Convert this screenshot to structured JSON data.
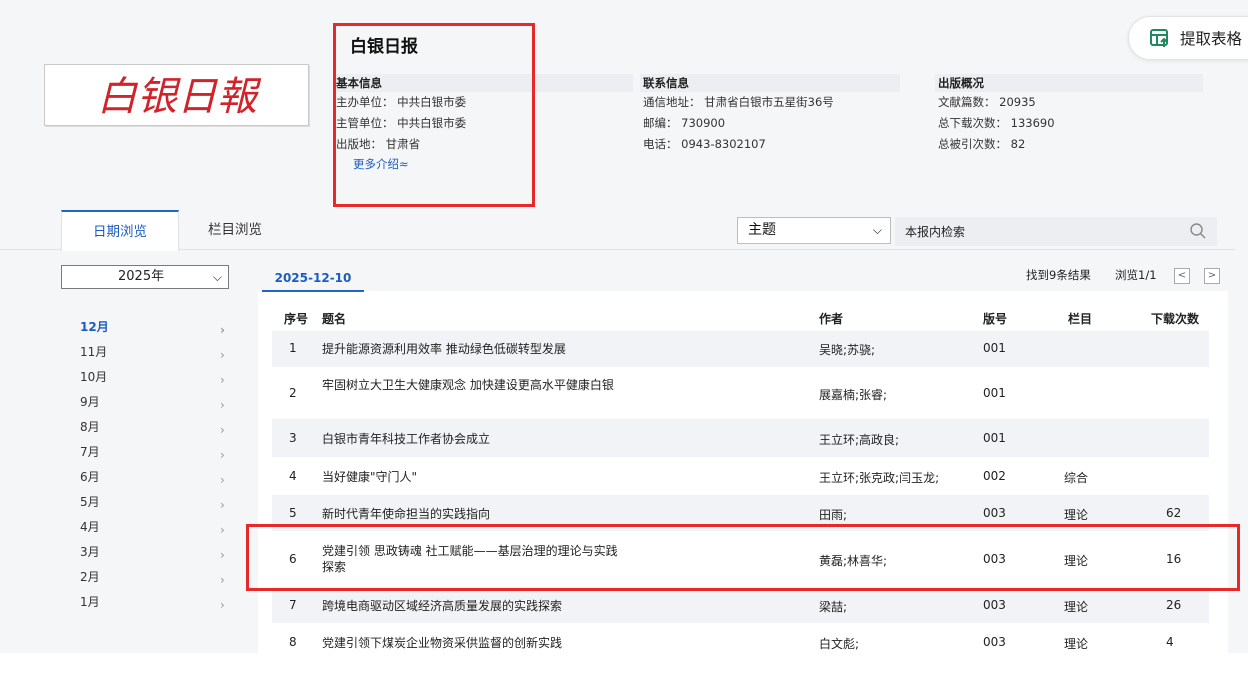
{
  "paper": {
    "name": "白银日报",
    "logo_text": "白银日報",
    "basic_info": {
      "heading": "基本信息",
      "sponsor": "主办单位： 中共白银市委",
      "supervisor": "主管单位： 中共白银市委",
      "place": "出版地： 甘肃省",
      "more": "更多介绍≈"
    },
    "contact_info": {
      "heading": "联系信息",
      "address": "通信地址： 甘肃省白银市五星街36号",
      "postcode": "邮编： 730900",
      "phone": "电话： 0943-8302107"
    },
    "publish_info": {
      "heading": "出版概况",
      "docs": "文献篇数： 20935",
      "downloads": "总下载次数： 133690",
      "cited": "总被引次数： 82"
    }
  },
  "toolbar": {
    "extract_label": "提取表格"
  },
  "tabs": [
    {
      "label": "日期浏览"
    },
    {
      "label": "栏目浏览"
    }
  ],
  "search": {
    "scope": "主题",
    "placeholder": "本报内检索"
  },
  "sidebar": {
    "year": "2025年",
    "months": [
      "12月",
      "11月",
      "10月",
      "9月",
      "8月",
      "7月",
      "6月",
      "5月",
      "4月",
      "3月",
      "2月",
      "1月"
    ]
  },
  "results": {
    "date_tab": "2025-12-10",
    "found": "找到9条结果",
    "browse": "浏览1/1",
    "prev": "<",
    "next": ">"
  },
  "table": {
    "headers": [
      "序号",
      "题名",
      "作者",
      "版号",
      "栏目",
      "下载次数"
    ],
    "rows": [
      {
        "no": "1",
        "title": "提升能源资源利用效率 推动绿色低碳转型发展",
        "author": "吴晓;苏骁;",
        "page": "001",
        "column": "",
        "downloads": ""
      },
      {
        "no": "2",
        "title": "牢固树立大卫生大健康观念 加快建设更高水平健康白银",
        "author": "展嘉楠;张睿;",
        "page": "001",
        "column": "",
        "downloads": ""
      },
      {
        "no": "3",
        "title": "白银市青年科技工作者协会成立",
        "author": "王立环;高政良;",
        "page": "001",
        "column": "",
        "downloads": ""
      },
      {
        "no": "4",
        "title": "当好健康\"守门人\"",
        "author": "王立环;张克政;闫玉龙;",
        "page": "002",
        "column": "综合",
        "downloads": ""
      },
      {
        "no": "5",
        "title": "新时代青年使命担当的实践指向",
        "author": "田雨;",
        "page": "003",
        "column": "理论",
        "downloads": "62"
      },
      {
        "no": "6",
        "title": "党建引领 思政铸魂 社工赋能——基层治理的理论与实践探索",
        "author": "黄磊;林喜华;",
        "page": "003",
        "column": "理论",
        "downloads": "16"
      },
      {
        "no": "7",
        "title": "跨境电商驱动区域经济高质量发展的实践探索",
        "author": "梁喆;",
        "page": "003",
        "column": "理论",
        "downloads": "26"
      },
      {
        "no": "8",
        "title": "党建引领下煤炭企业物资采供监督的创新实践",
        "author": "白文彪;",
        "page": "003",
        "column": "理论",
        "downloads": "4"
      }
    ]
  },
  "colors": {
    "accent": "#1f64c8",
    "highlight_box": "#e8292a",
    "logo_red": "#d2232a"
  }
}
